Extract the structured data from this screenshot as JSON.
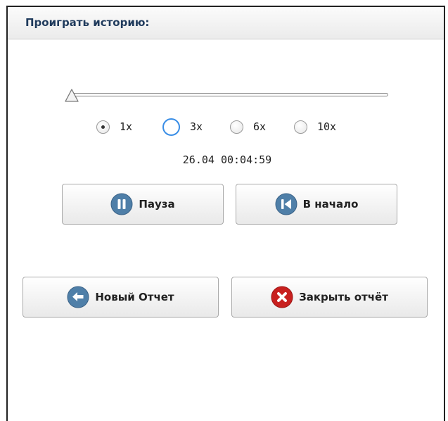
{
  "panel": {
    "title": "Проиграть историю:"
  },
  "playback": {
    "progress": 0.0,
    "speed_options": [
      "1x",
      "3x",
      "6x",
      "10x"
    ],
    "selected_speed": "1x",
    "timestamp": "26.04 00:04:59"
  },
  "buttons": {
    "pause_label": "Пауза",
    "restart_label": "В начало",
    "new_report_label": "Новый Отчет",
    "close_report_label": "Закрыть отчёт"
  },
  "colors": {
    "icon_blue": "#4f7fa8",
    "icon_red": "#c8201f",
    "focus_ring": "#3a8ee6"
  },
  "icons": {
    "pause": "pause-icon",
    "restart": "skip-to-start-icon",
    "new_report": "back-arrow-icon",
    "close_report": "close-icon"
  }
}
